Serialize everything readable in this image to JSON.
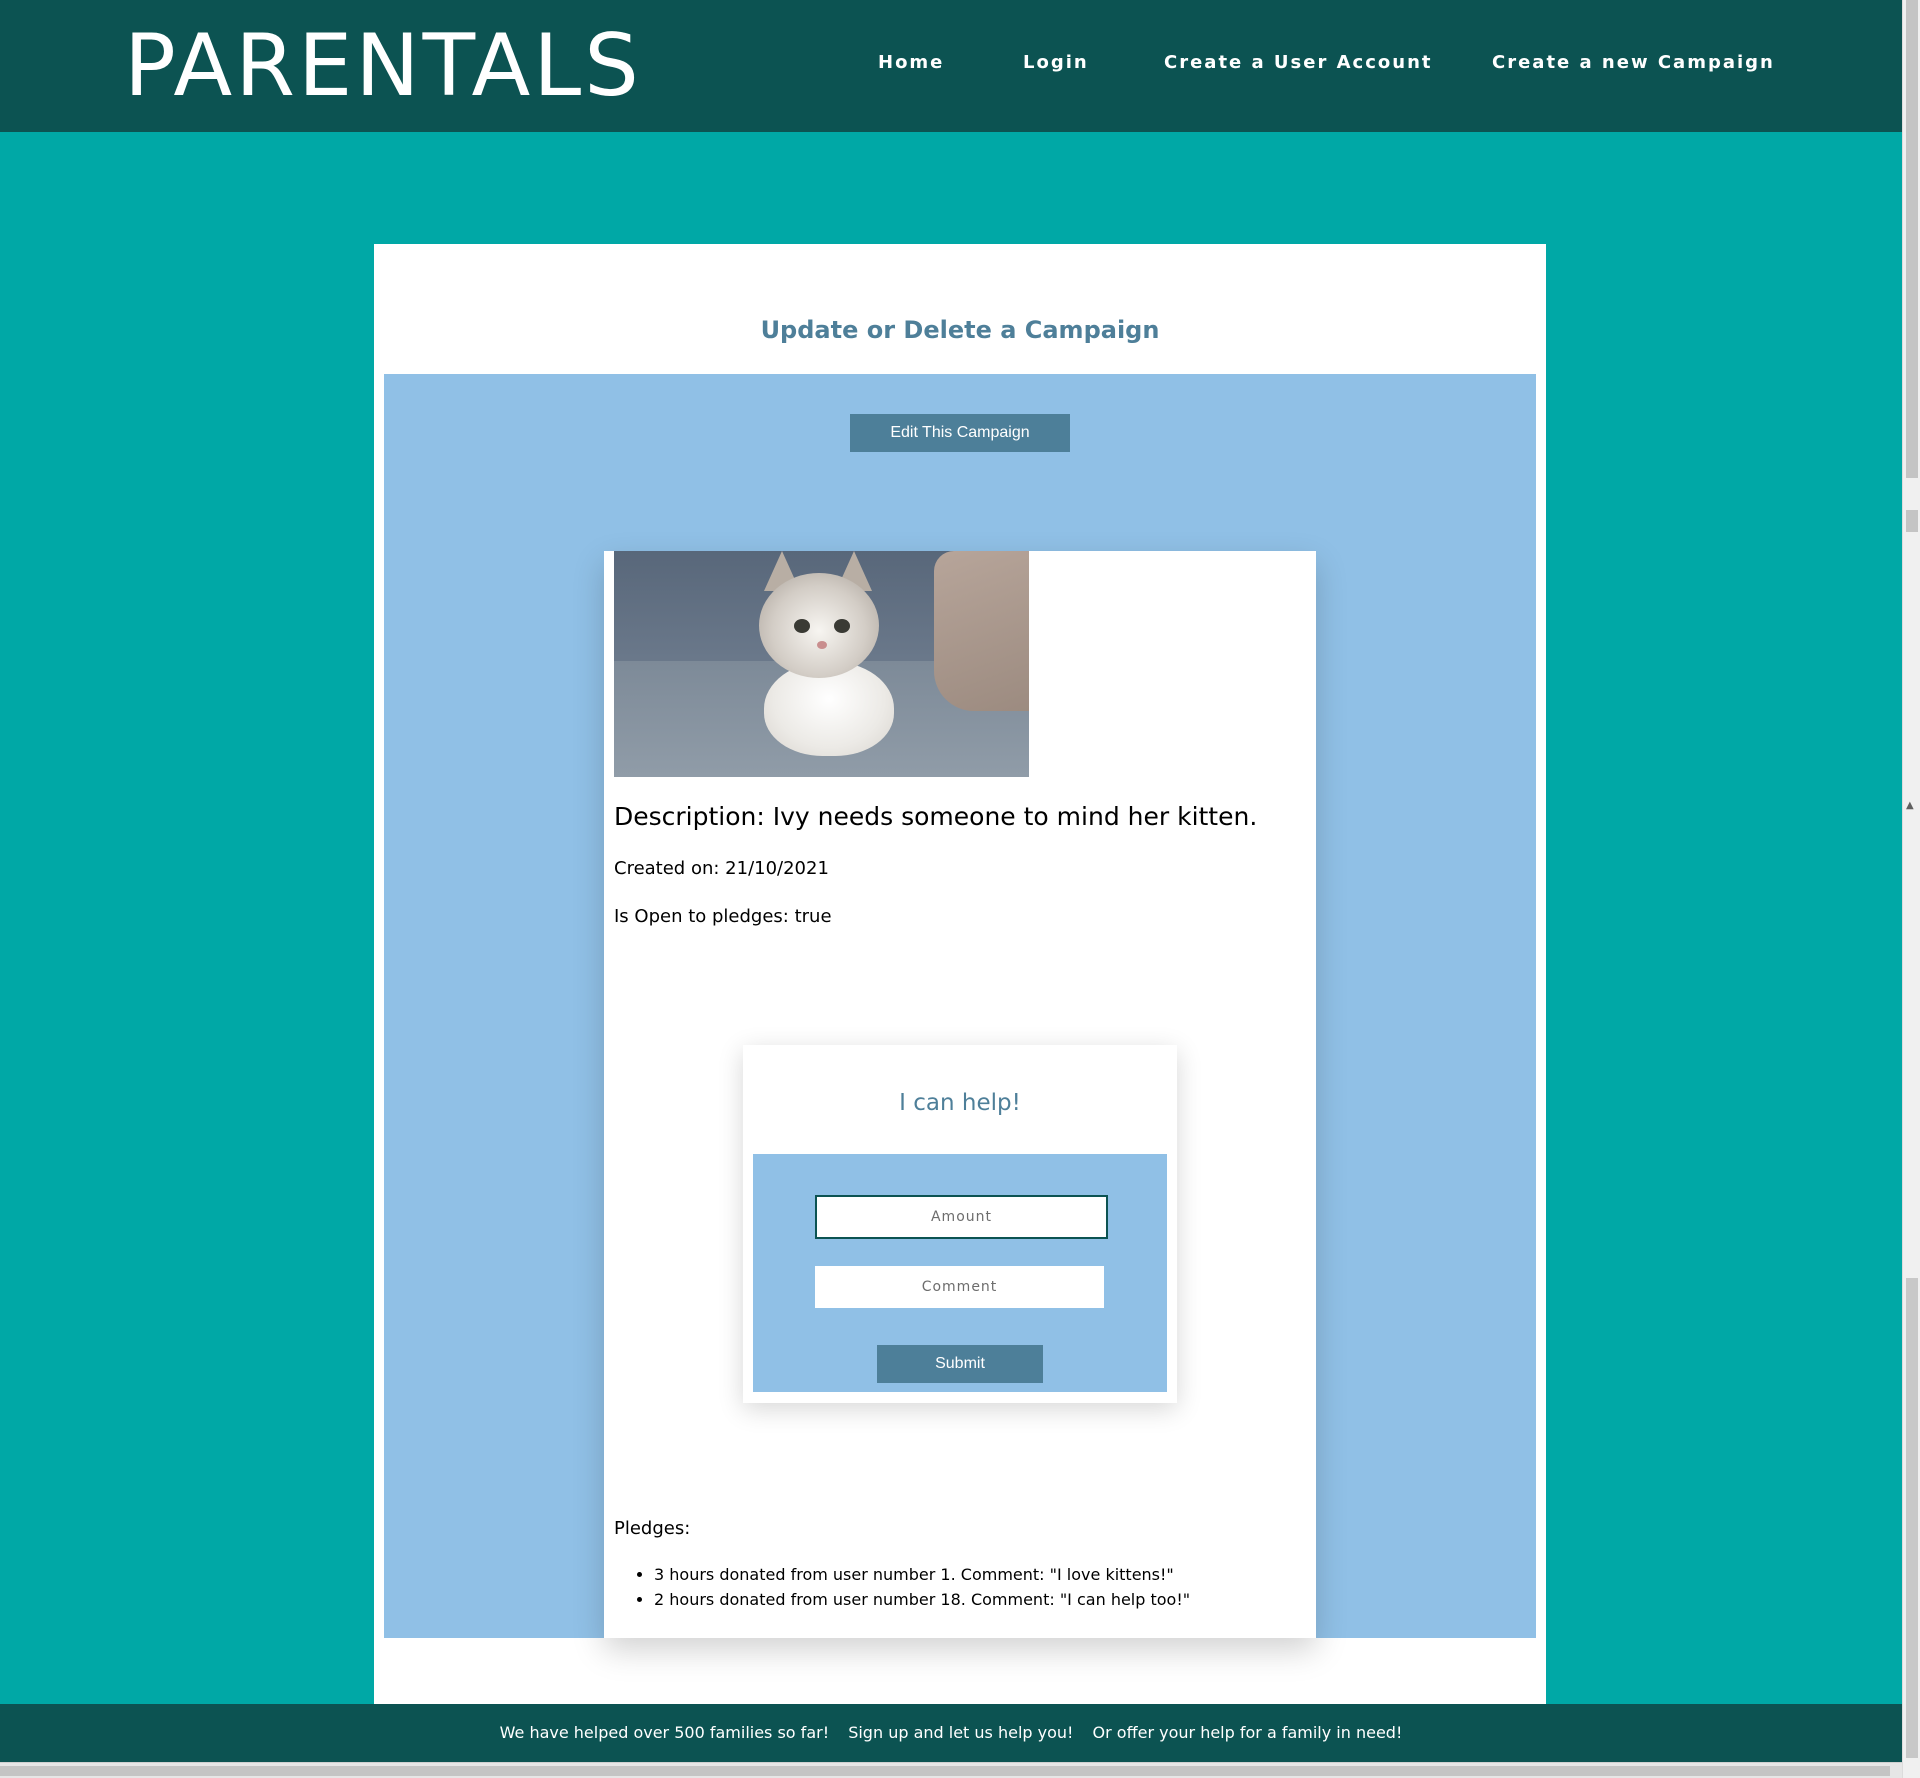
{
  "header": {
    "brand": "PARENTALS",
    "nav": {
      "home": "Home",
      "login": "Login",
      "create_user": "Create a User Account",
      "create_campaign": "Create a new Campaign"
    }
  },
  "main": {
    "title": "Update or Delete a Campaign",
    "edit_button": "Edit This Campaign",
    "campaign": {
      "image_icon": "kitten-photo",
      "description": "Description: Ivy needs someone to mind her kitten.",
      "created": "Created on: 21/10/2021",
      "open": "Is Open to pledges: true"
    },
    "pledge_form": {
      "title": "I can help!",
      "amount_placeholder": "Amount",
      "comment_placeholder": "Comment",
      "submit_label": "Submit"
    },
    "pledges": {
      "heading": "Pledges:",
      "items": [
        "3 hours donated from user number 1. Comment: \"I love kittens!\"",
        "2 hours donated from user number 18. Comment: \"I can help too!\""
      ]
    }
  },
  "footer": {
    "messages": [
      "We have helped over 500 families so far!",
      "Sign up and let us help you!",
      "Or offer your help for a family in need!"
    ]
  },
  "colors": {
    "header": "#0c5352",
    "background": "#00a8a6",
    "panel_blue": "#90c0e6",
    "button": "#4d7f99"
  }
}
